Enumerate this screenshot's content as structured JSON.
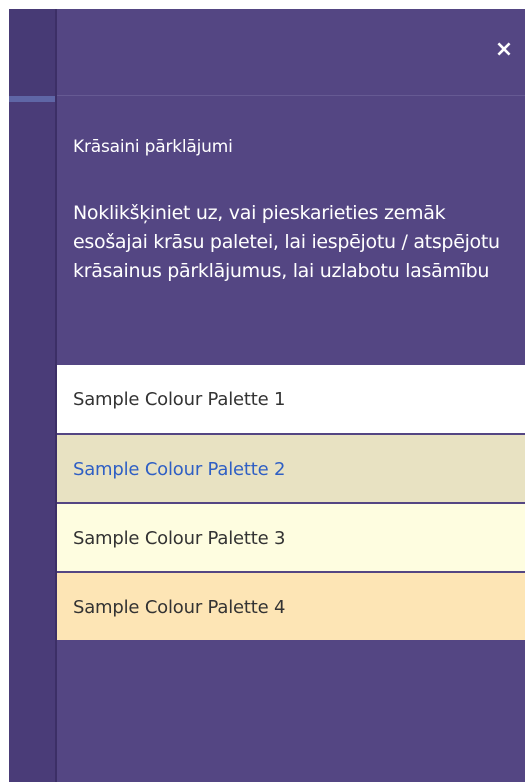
{
  "panel": {
    "close_label": "×",
    "title": "Krāsaini pārklājumi",
    "description": "Noklikšķiniet uz, vai pieskarieties zemāk esošajai krāsu paletei, lai iespējotu / atspējotu krāsainus pārklājumus, lai uzlabotu lasāmību",
    "palettes": [
      {
        "label": "Sample Colour Palette 1",
        "background": "#ffffff",
        "text_color": "#333333"
      },
      {
        "label": "Sample Colour Palette 2",
        "background": "#e8e2c2",
        "text_color": "#2f5fc4"
      },
      {
        "label": "Sample Colour Palette 3",
        "background": "#fefde0",
        "text_color": "#333333"
      },
      {
        "label": "Sample Colour Palette 4",
        "background": "#fde5b5",
        "text_color": "#333333"
      }
    ]
  },
  "colors": {
    "panel_background": "#544683",
    "backdrop": "#4a3c78",
    "accent": "#5f66a6"
  },
  "icons": {
    "close": "close-icon"
  }
}
